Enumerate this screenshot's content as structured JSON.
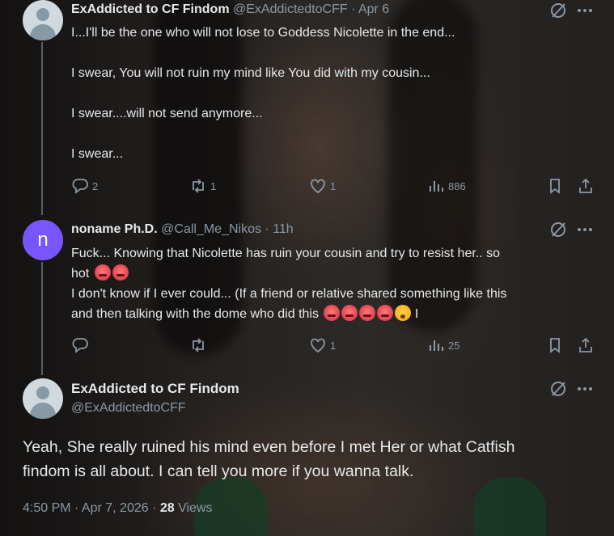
{
  "tweets": [
    {
      "display_name": "ExAddicted to CF Findom",
      "handle_time": "@ExAddictedtoCFF · Apr 6",
      "lines": [
        "I...I'll be the one who will not lose to Goddess Nicolette in the end...",
        "I swear, You will not ruin my mind like You did with my cousin...",
        "I swear....will not send anymore...",
        "I swear..."
      ],
      "replies": "2",
      "reposts": "1",
      "likes": "1",
      "views": "886"
    },
    {
      "avatar_letter": "n",
      "display_name": "noname Ph.D.",
      "handle_time": "@Call_Me_Nikos · 11h",
      "line1": "Fuck... Knowing that Nicolette has ruin your cousin and try to resist her.. so",
      "line2": "hot",
      "line3": "I don't know if I ever could... (If a friend or relative shared something like this",
      "line4": "and then talking with the dome who did this",
      "line4_tail": "I",
      "emoji_line2": [
        "hot-face",
        "hot-face"
      ],
      "emoji_line4": [
        "hot-face",
        "hot-face",
        "hot-face",
        "hot-face",
        "dizzy-face"
      ],
      "replies": "",
      "reposts": "",
      "likes": "1",
      "views": "25"
    }
  ],
  "focused": {
    "display_name": "ExAddicted to CF Findom",
    "handle": "@ExAddictedtoCFF",
    "text_line1": "Yeah, She really ruined his mind even before I met Her or what Catfish",
    "text_line2": "findom is all about. I can tell you more if you wanna talk.",
    "timestamp": "4:50 PM · Apr 7, 2026 · ",
    "views_count": "28",
    "views_label": " Views"
  },
  "icons": {
    "grok": "grok-slash-icon",
    "more": "more-icon",
    "reply": "reply-icon",
    "repost": "repost-icon",
    "like": "like-icon",
    "views": "views-icon",
    "bookmark": "bookmark-icon",
    "share": "share-icon"
  },
  "colors": {
    "text": "#e7e9ea",
    "muted": "#8b98a5",
    "avatar_letter_bg": "#7856ff"
  }
}
